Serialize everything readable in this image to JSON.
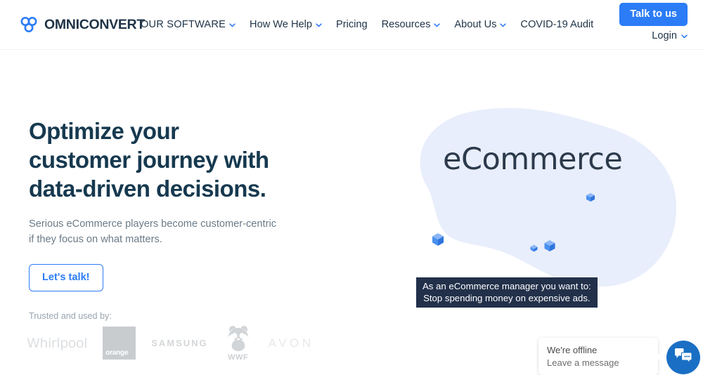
{
  "header": {
    "logo": {
      "text": "OMNICONVERT",
      "icon": "omniconvert-trefoil-logo",
      "color": "#2b7cf6"
    },
    "nav": [
      {
        "label": "OUR SOFTWARE",
        "has_chevron": true
      },
      {
        "label": "How We Help",
        "has_chevron": true
      },
      {
        "label": "Pricing",
        "has_chevron": false
      },
      {
        "label": "Resources",
        "has_chevron": true
      },
      {
        "label": "About Us",
        "has_chevron": true
      },
      {
        "label": "COVID-19 Audit",
        "has_chevron": false
      }
    ],
    "cta_button": {
      "label": "Talk to us",
      "color": "#2b7cf6"
    },
    "login": {
      "label": "Login",
      "has_chevron": true
    }
  },
  "hero": {
    "headline_line1": "Optimize your",
    "headline_line2": "customer journey with",
    "headline_line3": "data-driven decisions.",
    "headline_color": "#16394f",
    "subtext": "Serious eCommerce players become customer-centric if they focus on what matters.",
    "cta_button": {
      "label": "Let's talk!",
      "color": "#2b7cf6"
    },
    "trusted_label": "Trusted and used by:",
    "brands": [
      {
        "name": "Whirlpool",
        "label": "Whirlpool"
      },
      {
        "name": "orange",
        "label": "orange"
      },
      {
        "name": "Samsung",
        "label": "SAMSUNG"
      },
      {
        "name": "WWF",
        "label": "WWF"
      },
      {
        "name": "Avon",
        "label": "AVON"
      }
    ]
  },
  "illustration": {
    "word": "eCommerce",
    "blob_color": "#e8eefb",
    "cube_color": "#4a90f0",
    "caption_line1": "As an eCommerce manager you want to:",
    "caption_line2": "Stop spending money on expensive ads.",
    "caption_bg": "#22304a"
  },
  "chat_widget": {
    "line1": "We're offline",
    "line2": "Leave a message",
    "fab_icon": "chat-bubbles-icon",
    "fab_color": "#1a6fc4"
  }
}
